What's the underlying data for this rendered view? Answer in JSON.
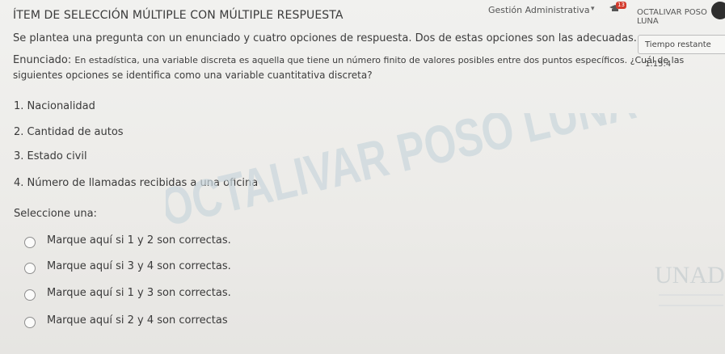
{
  "header": {
    "department": "Gestión Administrativa",
    "notification_count": "13",
    "user_name": "OCTALIVAR POSO LUNA"
  },
  "item": {
    "title": "ÍTEM DE SELECCIÓN MÚLTIPLE CON MÚLTIPLE RESPUESTA",
    "timer": "Tiempo restante 1:15:4",
    "description": "Se plantea una pregunta con un enunciado y cuatro opciones de respuesta. Dos de estas opciones son las adecuadas.",
    "statement_label": "Enunciado:",
    "statement_line1": "En estadística, una variable discreta es aquella que tiene un número finito de valores posibles entre dos puntos específicos. ¿Cuál de las",
    "statement_line2": "siguientes opciones se identifica como una variable cuantitativa discreta?",
    "options": [
      "1. Nacionalidad",
      "2. Cantidad de autos",
      "3. Estado civil",
      "4. Número de llamadas recibidas a una oficina"
    ],
    "select_label": "Seleccione una:",
    "answers": [
      "Marque aquí si 1 y 2 son correctas.",
      "Marque aquí si 3 y 4 son correctas.",
      "Marque aquí si 1 y 3 son correctas.",
      "Marque aquí si 2 y 4 son correctas"
    ]
  },
  "watermark": {
    "text": "OCTALIVAR POSO LUNA",
    "color": "#c9d5dc"
  },
  "logo": {
    "text": "UNAD",
    "color": "#c8ced1"
  },
  "colors": {
    "badge": "#d33a2c"
  }
}
